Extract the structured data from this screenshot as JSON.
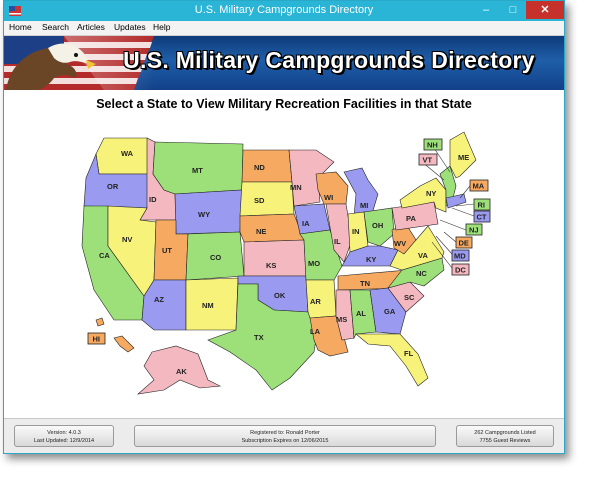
{
  "window": {
    "title": "U.S. Military Campgrounds Directory",
    "min_glyph": "–",
    "max_glyph": "□",
    "close_glyph": "✕"
  },
  "menu": [
    {
      "label": "Home"
    },
    {
      "label": "Search"
    },
    {
      "label": "Articles"
    },
    {
      "label": "Updates"
    },
    {
      "label": "Help"
    }
  ],
  "banner": {
    "title": "U.S. Military Campgrounds Directory"
  },
  "map": {
    "heading": "Select a State to View Military Recreation Facilities in that State",
    "states": {
      "WA": "WA",
      "OR": "OR",
      "CA": "CA",
      "ID": "ID",
      "NV": "NV",
      "MT": "MT",
      "WY": "WY",
      "UT": "UT",
      "AZ": "AZ",
      "CO": "CO",
      "NM": "NM",
      "ND": "ND",
      "SD": "SD",
      "NE": "NE",
      "KS": "KS",
      "OK": "OK",
      "TX": "TX",
      "MN": "MN",
      "IA": "IA",
      "MO": "MO",
      "AR": "AR",
      "LA": "LA",
      "WI": "WI",
      "IL": "IL",
      "MI": "MI",
      "IN": "IN",
      "OH": "OH",
      "KY": "KY",
      "TN": "TN",
      "MS": "MS",
      "AL": "AL",
      "GA": "GA",
      "FL": "FL",
      "SC": "SC",
      "NC": "NC",
      "VA": "VA",
      "WV": "WV",
      "PA": "PA",
      "NY": "NY",
      "ME": "ME",
      "AK": "AK"
    },
    "small_states": {
      "NH": "NH",
      "VT": "VT",
      "MA": "MA",
      "RI": "RI",
      "CT": "CT",
      "NJ": "NJ",
      "DE": "DE",
      "MD": "MD",
      "DC": "DC",
      "HI": "HI"
    }
  },
  "status": {
    "version": "Version: 4.0.3",
    "updated": "Last Updated: 12/9/2014",
    "registered": "Registered to: Ronald Porter",
    "subscription": "Subscription Expires on 12/06/2015",
    "campgrounds": "262 Campgrounds Listed",
    "reviews": "7755 Guest Reviews"
  },
  "colors": {
    "titlebar": "#2ab4d6",
    "close": "#c7312c",
    "green": "#9de07a",
    "yellow": "#f7f27a",
    "pink": "#f4b8c0",
    "orange": "#f6a960",
    "blue": "#9a9af0"
  }
}
